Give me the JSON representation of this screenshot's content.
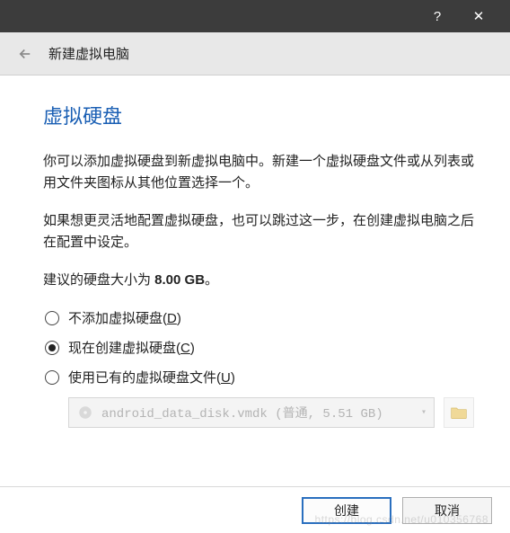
{
  "titlebar": {
    "help": "?",
    "close": "✕"
  },
  "nav": {
    "title": "新建虚拟电脑"
  },
  "page": {
    "heading": "虚拟硬盘",
    "para1": "你可以添加虚拟硬盘到新虚拟电脑中。新建一个虚拟硬盘文件或从列表或用文件夹图标从其他位置选择一个。",
    "para2": "如果想更灵活地配置虚拟硬盘，也可以跳过这一步，在创建虚拟电脑之后在配置中设定。",
    "rec_prefix": "建议的硬盘大小为 ",
    "rec_size": "8.00 GB",
    "rec_suffix": "。"
  },
  "options": {
    "none": {
      "label": "不添加虚拟硬盘(",
      "ak": "D",
      "tail": ")"
    },
    "create": {
      "label": "现在创建虚拟硬盘(",
      "ak": "C",
      "tail": ")"
    },
    "existing": {
      "label": "使用已有的虚拟硬盘文件(",
      "ak": "U",
      "tail": ")"
    }
  },
  "file": {
    "display": "android_data_disk.vmdk (普通, 5.51 GB)"
  },
  "footer": {
    "create": "创建",
    "cancel": "取消"
  },
  "watermark": "https://blog.csdn.net/u010356768"
}
